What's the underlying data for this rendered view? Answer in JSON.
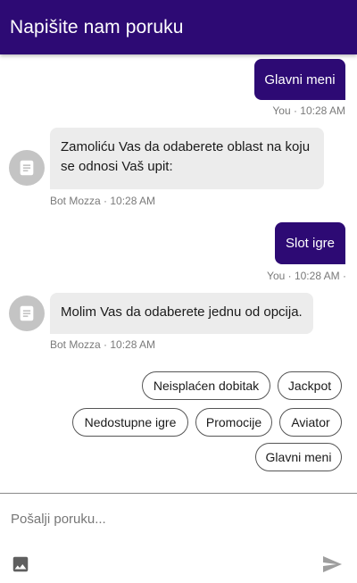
{
  "header": {
    "title": "Napišite nam poruku"
  },
  "messages": [
    {
      "sender": "user",
      "text": "Glavni meni",
      "meta": "You · 10:28 AM"
    },
    {
      "sender": "bot",
      "text": "Zamoliću Vas da odaberete oblast na koju se odnosi Vaš upit:",
      "meta": "Bot Mozza · 10:28 AM",
      "avatar_icon": "chat-document-icon"
    },
    {
      "sender": "user",
      "text": "Slot igre",
      "meta": "You · 10:28 AM ·"
    },
    {
      "sender": "bot",
      "text": "Molim Vas da odaberete jednu od opcija.",
      "meta": "Bot Mozza · 10:28 AM",
      "avatar_icon": "chat-document-icon"
    }
  ],
  "quick_replies": [
    "Neisplaćen dobitak",
    "Jackpot",
    "Nedostupne igre",
    "Promocije",
    "Aviator",
    "Glavni meni"
  ],
  "composer": {
    "placeholder": "Pošalji poruku...",
    "attach_icon": "image-icon",
    "send_icon": "send-icon"
  },
  "colors": {
    "brand": "#2d0a74",
    "bot_bubble": "#ececec",
    "avatar": "#c4c4c4"
  }
}
